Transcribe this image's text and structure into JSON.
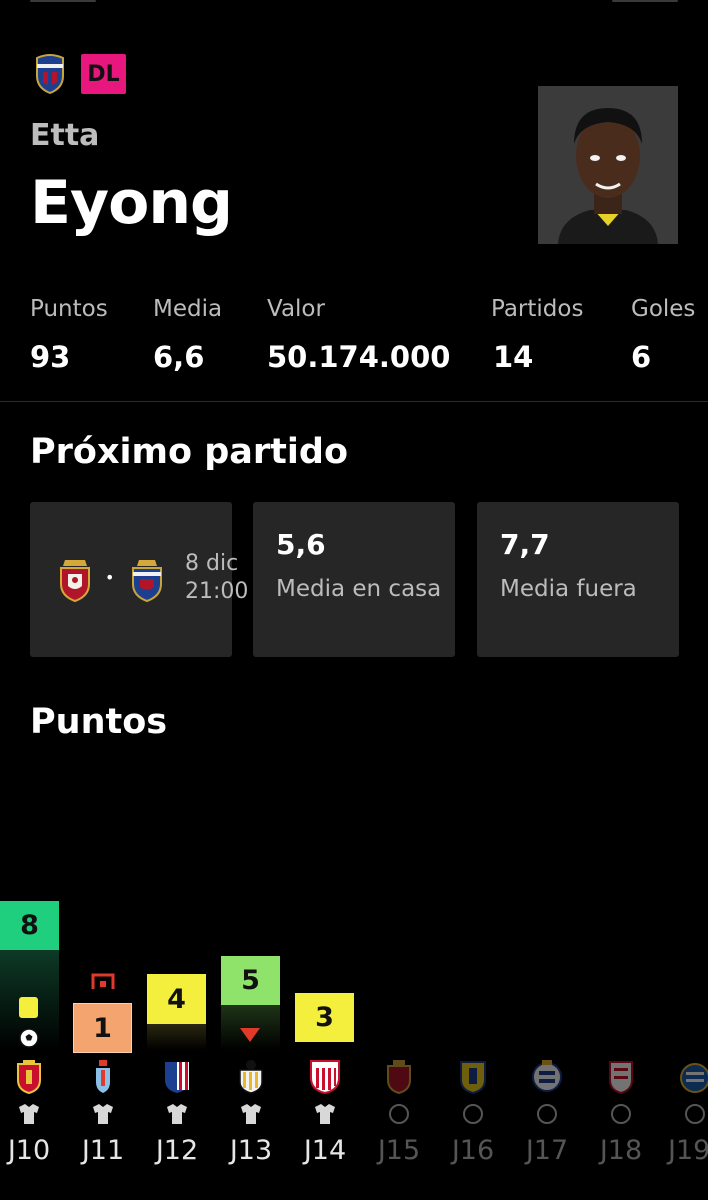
{
  "player": {
    "position_badge": "DL",
    "first_name": "Etta",
    "last_name": "Eyong"
  },
  "stats": [
    {
      "label": "Puntos",
      "value": "93"
    },
    {
      "label": "Media",
      "value": "6,6"
    },
    {
      "label": "Valor",
      "value": "50.174.000"
    },
    {
      "label": "Partidos",
      "value": "14"
    },
    {
      "label": "Goles",
      "value": "6"
    }
  ],
  "next_match": {
    "title": "Próximo partido",
    "separator": "•",
    "date": "8 dic",
    "time": "21:00",
    "home_avg": {
      "value": "5,6",
      "label": "Media en casa"
    },
    "away_avg": {
      "value": "7,7",
      "label": "Media fuera"
    }
  },
  "points_section": {
    "title": "Puntos",
    "rounds": [
      {
        "label": "J10",
        "points": "8",
        "color": "#1fcf7e",
        "played": true,
        "opponent": "mallorca-crest-icon"
      },
      {
        "label": "J11",
        "points": "1",
        "color": "#f4a46e",
        "played": true,
        "opponent": "celta-crest-icon"
      },
      {
        "label": "J12",
        "points": "4",
        "color": "#f4ee3c",
        "played": true,
        "opponent": "atletico-crest-icon"
      },
      {
        "label": "J13",
        "points": "5",
        "color": "#8fe36b",
        "played": true,
        "opponent": "valencia-crest-icon"
      },
      {
        "label": "J14",
        "points": "3",
        "color": "#f4ee3c",
        "played": true,
        "opponent": "athletic-crest-icon"
      },
      {
        "label": "J15",
        "points": "",
        "played": false,
        "opponent": "osasuna-crest-icon"
      },
      {
        "label": "J16",
        "points": "",
        "played": false,
        "opponent": "villarreal-crest-icon"
      },
      {
        "label": "J17",
        "points": "",
        "played": false,
        "opponent": "real-sociedad-crest-icon"
      },
      {
        "label": "J18",
        "points": "",
        "played": false,
        "opponent": "sevilla-crest-icon"
      },
      {
        "label": "J19",
        "points": "",
        "played": false,
        "opponent": "espanyol-crest-icon"
      }
    ]
  },
  "colors": {
    "badge_dl": "#e8177e",
    "card_bg": "#262626",
    "played_label": "#e6e6e6",
    "upcoming_label": "#555555"
  }
}
